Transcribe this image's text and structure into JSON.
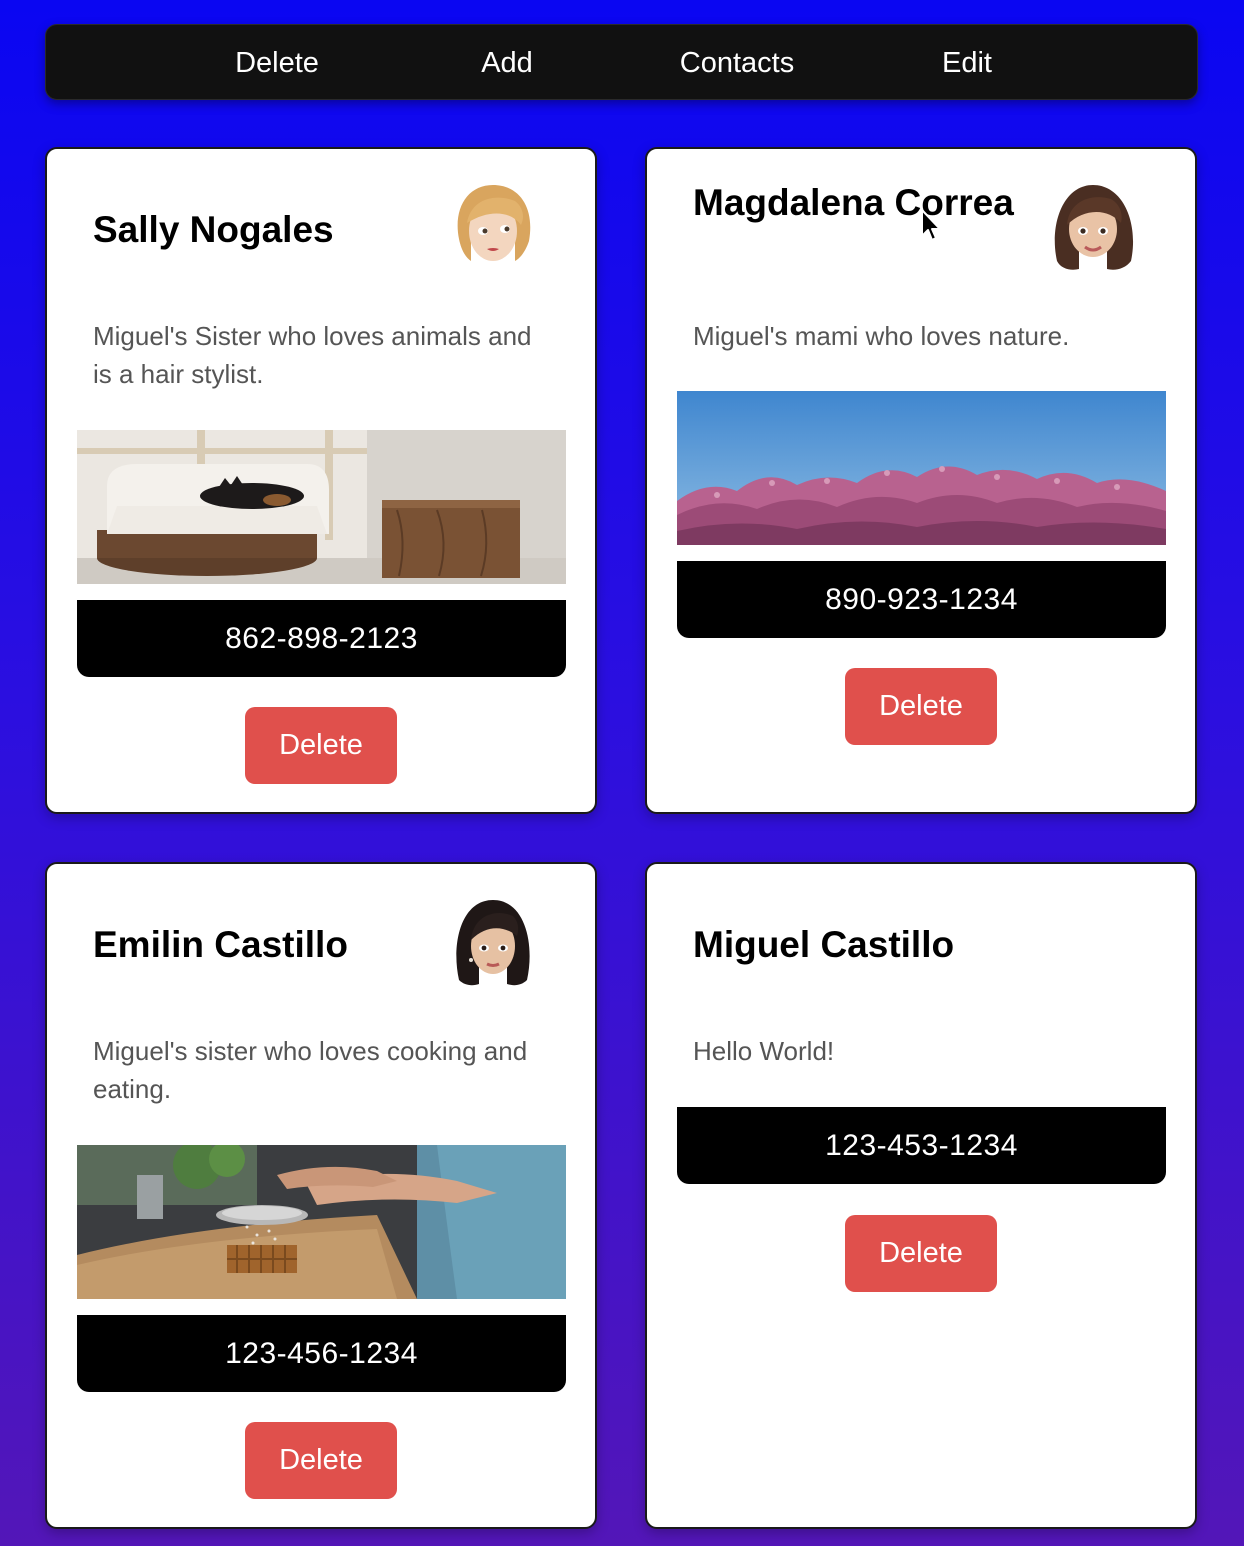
{
  "nav": {
    "items": [
      {
        "label": "Delete"
      },
      {
        "label": "Add"
      },
      {
        "label": "Contacts"
      },
      {
        "label": "Edit"
      }
    ]
  },
  "contacts": [
    {
      "name": "Sally Nogales",
      "description": "Miguel's Sister who loves animals and is a hair stylist.",
      "phone": "862-898-2123",
      "delete_label": "Delete",
      "avatar_icon": "blonde-woman-memoji-icon",
      "photo": "cat-on-white-sofa-image"
    },
    {
      "name": "Magdalena Correa",
      "description": "Miguel's mami who loves nature.",
      "phone": "890-923-1234",
      "delete_label": "Delete",
      "avatar_icon": "brunette-woman-memoji-icon",
      "photo": "pink-blossom-trees-sky-image"
    },
    {
      "name": "Emilin Castillo",
      "description": "Miguel's sister who loves cooking and eating.",
      "phone": "123-456-1234",
      "delete_label": "Delete",
      "avatar_icon": "dark-hair-woman-memoji-icon",
      "photo": "sifting-flour-baking-image"
    },
    {
      "name": "Miguel Castillo",
      "description": "Hello World!",
      "phone": "123-453-1234",
      "delete_label": "Delete"
    }
  ],
  "colors": {
    "background_top": "#0a06f2",
    "background_bottom": "#5316b8",
    "navbar": "#111111",
    "phone_bar": "#000000",
    "delete_button": "#e0504c",
    "description_text": "#555555"
  }
}
